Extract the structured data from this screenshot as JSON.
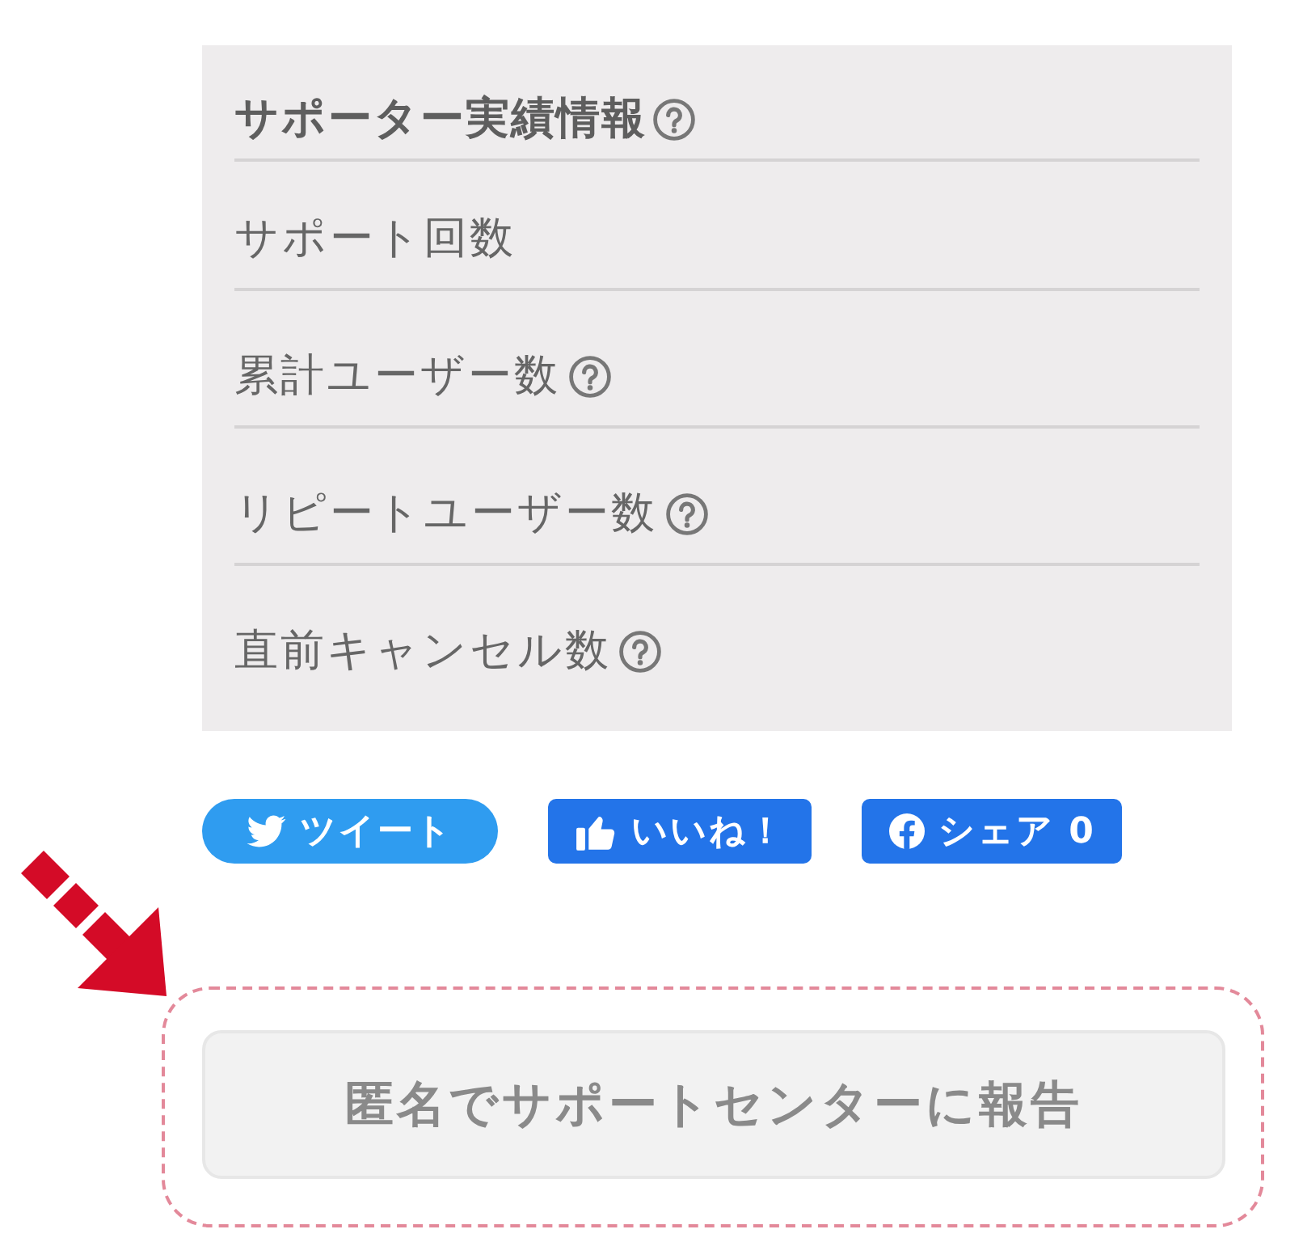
{
  "stats_panel": {
    "title": "サポーター実績情報",
    "help": true,
    "rows": [
      {
        "label": "サポート回数",
        "help": false
      },
      {
        "label": "累計ユーザー数",
        "help": true
      },
      {
        "label": "リピートユーザー数",
        "help": true
      },
      {
        "label": "直前キャンセル数",
        "help": true
      }
    ]
  },
  "share_buttons": [
    {
      "kind": "tweet",
      "label": "ツイート"
    },
    {
      "kind": "like",
      "label": "いいね！"
    },
    {
      "kind": "share",
      "label": "シェア",
      "count": "0"
    }
  ],
  "report_button": {
    "label": "匿名でサポートセンターに報告",
    "highlighted": true
  }
}
